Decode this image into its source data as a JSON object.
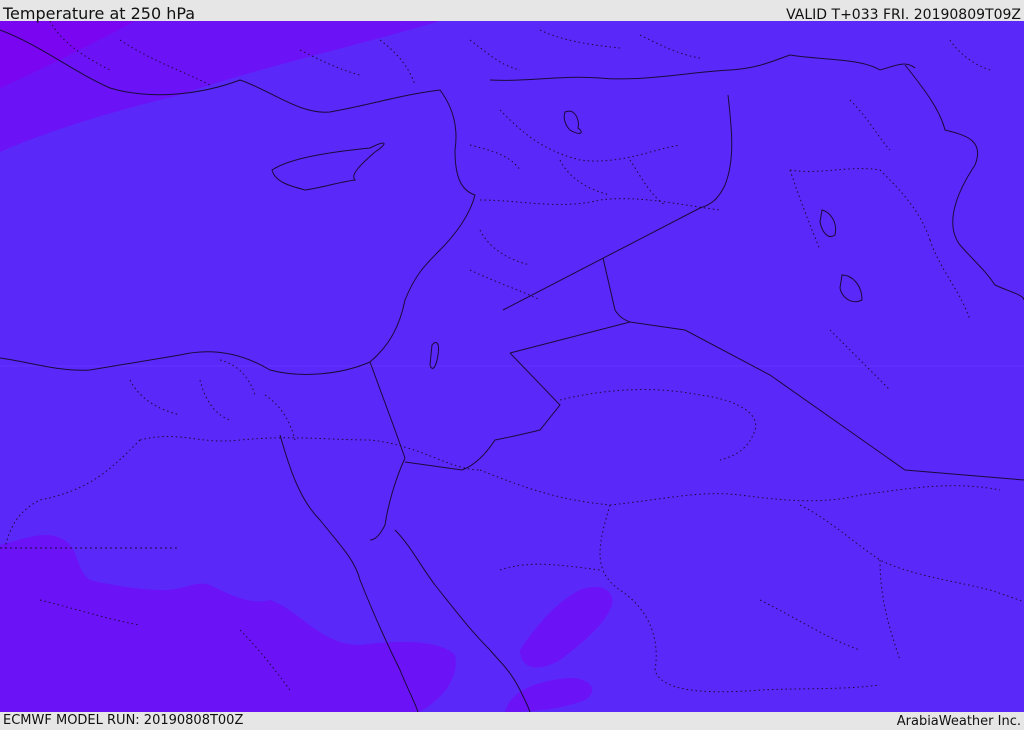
{
  "header": {
    "title": "Temperature at 250 hPa",
    "valid": "VALID T+033 FRI. 20190809T09Z"
  },
  "footer": {
    "model_run": "ECMWF MODEL RUN: 20190808T00Z",
    "credit": "ArabiaWeather Inc."
  },
  "map": {
    "colors": {
      "field_main": "#5b28fa",
      "field_warm_band": "#6c12f6",
      "field_far_corner": "#7a05f0",
      "border_line": "#1a0a3a"
    }
  }
}
